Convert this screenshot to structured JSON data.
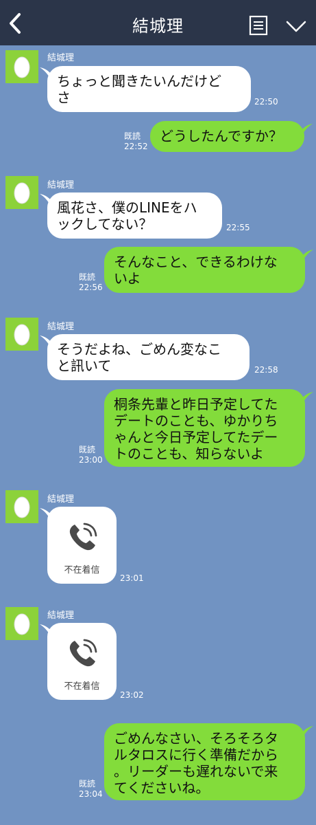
{
  "header": {
    "title": "結城理",
    "back_icon": "chevron-left-icon",
    "menu_icon": "list-icon",
    "down_icon": "chevron-down-icon"
  },
  "colors": {
    "background": "#7193c2",
    "header": "#2b3549",
    "outgoing": "#83dc3b",
    "incoming": "#ffffff",
    "avatar": "#8cd23a"
  },
  "messages": [
    {
      "sender": "結城理",
      "text": "ちょっと聞きたいんだけど\nさ",
      "time": "22:50"
    },
    {
      "read": "既読",
      "time": "22:52",
      "text": "どうしたんですか？"
    },
    {
      "sender": "結城理",
      "text": "風花さ、僕のLINEをハ\nックしてない？",
      "time": "22:55"
    },
    {
      "read": "既読",
      "time": "22:56",
      "text": "そんなこと、できるわけな\nいよ"
    },
    {
      "sender": "結城理",
      "text": "そうだよね、ごめん変なこ\nと訊いて",
      "time": "22:58"
    },
    {
      "read": "既読",
      "time": "23:00",
      "text": "桐条先輩と昨日予定してた\nデートのことも、ゆかりち\nゃんと今日予定してたデー\nトのことも、知らないよ"
    },
    {
      "sender": "結城理",
      "call_label": "不在着信",
      "time": "23:01",
      "icon": "phone-icon"
    },
    {
      "sender": "結城理",
      "call_label": "不在着信",
      "time": "23:02",
      "icon": "phone-icon"
    },
    {
      "read": "既読",
      "time": "23:04",
      "text": "ごめんなさい、そろそろタ\nルタロスに行く準備だから\n。リーダーも遅れないで来\nてくださいね。"
    }
  ]
}
